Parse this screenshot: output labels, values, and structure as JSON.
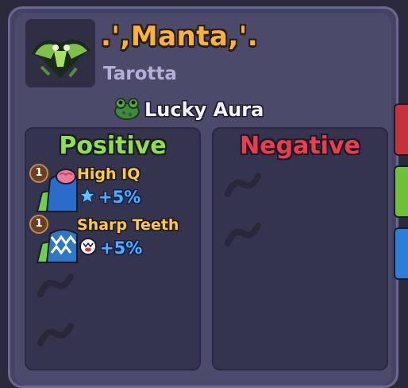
{
  "pet": {
    "name": ".',Manta,'.",
    "species": "Tarotta",
    "aura": "Lucky Aura",
    "image_icon": "manta-pet-icon",
    "aura_icon": "frog-icon"
  },
  "traits": {
    "positive": {
      "heading": "Positive",
      "color": "#8fe04a",
      "items": [
        {
          "rank": "1",
          "name": "High IQ",
          "bonus": "+5%",
          "icon": "brain-icon",
          "bonus_icon": "star-icon"
        },
        {
          "rank": "1",
          "name": "Sharp Teeth",
          "bonus": "+5%",
          "icon": "teeth-icon",
          "bonus_icon": "bite-icon"
        }
      ]
    },
    "negative": {
      "heading": "Negative",
      "color": "#ee3b4e",
      "items": []
    }
  },
  "colors": {
    "title": "#f6b43c",
    "subtitle": "#b3afd6",
    "bonus": "#4db0ff",
    "panel": "#35344e"
  }
}
